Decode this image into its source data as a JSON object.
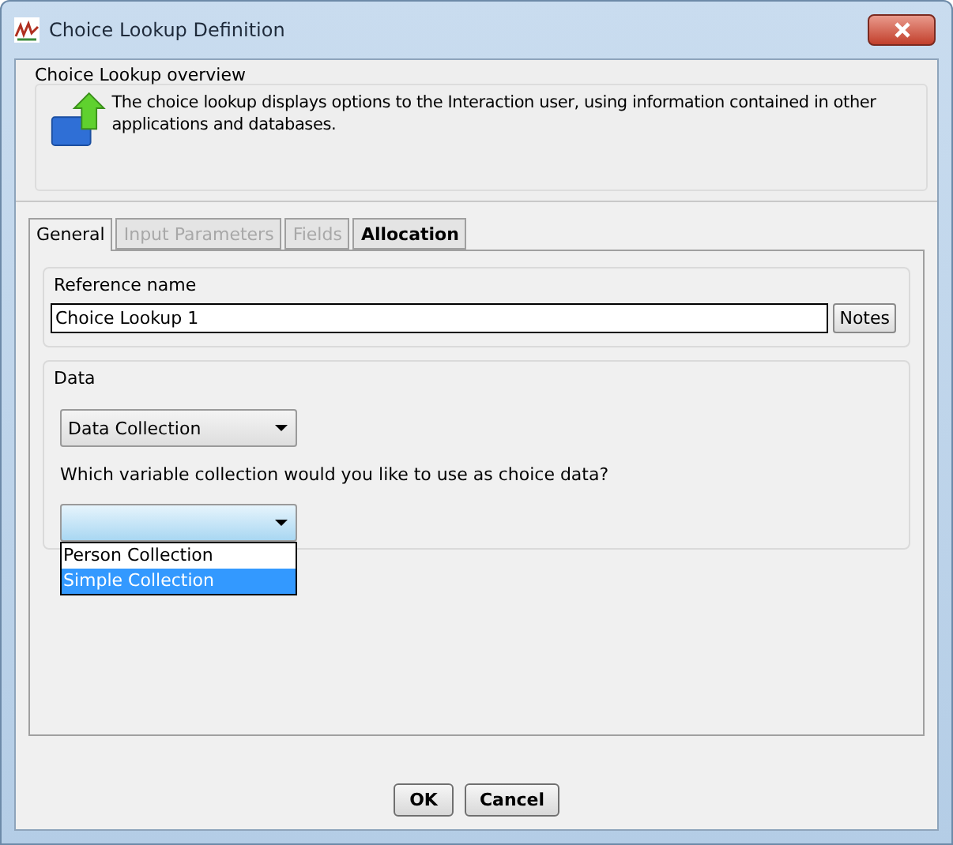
{
  "window": {
    "title": "Choice Lookup Definition"
  },
  "overview": {
    "title": "Choice Lookup overview",
    "description": "The choice lookup displays options to the Interaction user, using information contained in other applications and databases."
  },
  "tabs": [
    {
      "label": "General",
      "selected": true,
      "disabled": false
    },
    {
      "label": "Input Parameters",
      "selected": false,
      "disabled": true
    },
    {
      "label": "Fields",
      "selected": false,
      "disabled": true
    },
    {
      "label": "Allocation",
      "selected": false,
      "disabled": false
    }
  ],
  "reference": {
    "title": "Reference name",
    "value": "Choice Lookup 1",
    "notes_button": "Notes"
  },
  "data": {
    "title": "Data",
    "source": "Data Collection",
    "question": "Which variable collection would you like to use as choice data?",
    "collection": {
      "expanded": true,
      "options": [
        {
          "label": "Person Collection",
          "selected": false
        },
        {
          "label": "Simple Collection",
          "selected": true
        }
      ]
    }
  },
  "buttons": [
    "OK",
    "Cancel"
  ]
}
